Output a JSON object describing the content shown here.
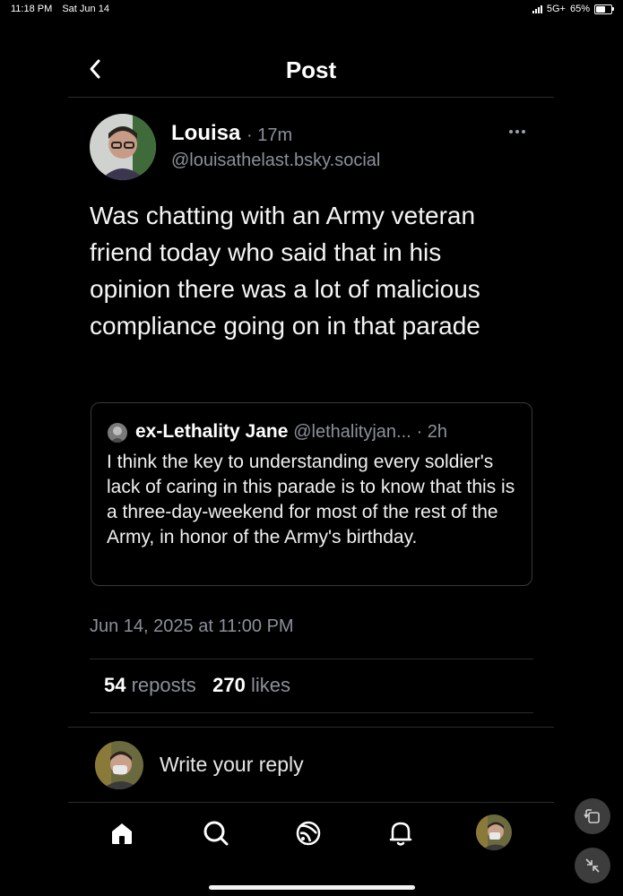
{
  "status_bar": {
    "time": "11:18 PM",
    "date": "Sat Jun 14",
    "network": "5G+",
    "battery": "65%",
    "battery_level": 0.65
  },
  "header": {
    "title": "Post"
  },
  "post": {
    "author": "Louisa",
    "time": "· 17m",
    "handle": "@louisathelast.bsky.social",
    "text": "Was chatting with an Army veteran friend today who said that in his opinion there was a lot of malicious compliance going on in that parade",
    "date": "Jun 14, 2025 at 11:00 PM",
    "reposts_count": "54",
    "reposts_label": "reposts",
    "likes_count": "270",
    "likes_label": "likes"
  },
  "quote": {
    "author": "ex-Lethality Jane",
    "handle": "@lethalityjan...",
    "time": "· 2h",
    "text": "I think the key to understanding every soldier's lack of caring in this parade is to know that this is a three-day-weekend for most of the rest of the Army, in honor of the Army's birthday."
  },
  "reply": {
    "placeholder": "Write your reply"
  },
  "nav": {
    "items": [
      {
        "icon": "home-icon"
      },
      {
        "icon": "search-icon"
      },
      {
        "icon": "feeds-icon"
      },
      {
        "icon": "notifications-icon"
      },
      {
        "icon": "profile-avatar"
      }
    ]
  },
  "overlay": {
    "icons": [
      "rotate-icon",
      "minimize-icon"
    ]
  },
  "colors": {
    "background": "#000000",
    "secondary_text": "#8c9099",
    "divider": "#2b2b2b"
  }
}
